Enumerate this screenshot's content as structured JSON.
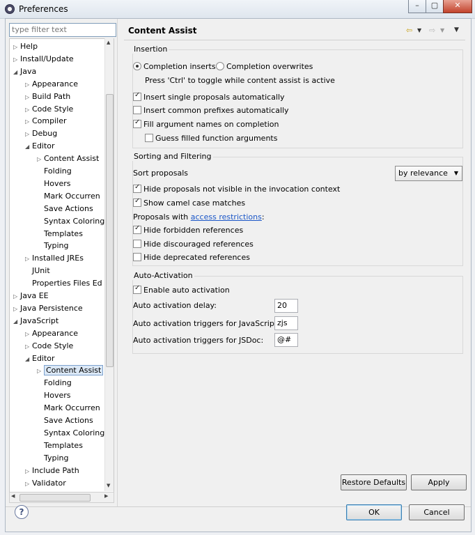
{
  "window": {
    "title": "Preferences"
  },
  "filter": {
    "placeholder": "type filter text"
  },
  "tree": [
    {
      "label": "Help",
      "twisty": "▷",
      "indent": 0
    },
    {
      "label": "Install/Update",
      "twisty": "▷",
      "indent": 0
    },
    {
      "label": "Java",
      "twisty": "◢",
      "indent": 0
    },
    {
      "label": "Appearance",
      "twisty": "▷",
      "indent": 1
    },
    {
      "label": "Build Path",
      "twisty": "▷",
      "indent": 1
    },
    {
      "label": "Code Style",
      "twisty": "▷",
      "indent": 1
    },
    {
      "label": "Compiler",
      "twisty": "▷",
      "indent": 1
    },
    {
      "label": "Debug",
      "twisty": "▷",
      "indent": 1
    },
    {
      "label": "Editor",
      "twisty": "◢",
      "indent": 1
    },
    {
      "label": "Content Assist",
      "twisty": "▷",
      "indent": 2
    },
    {
      "label": "Folding",
      "twisty": "",
      "indent": 2
    },
    {
      "label": "Hovers",
      "twisty": "",
      "indent": 2
    },
    {
      "label": "Mark Occurren",
      "twisty": "",
      "indent": 2
    },
    {
      "label": "Save Actions",
      "twisty": "",
      "indent": 2
    },
    {
      "label": "Syntax Coloring",
      "twisty": "",
      "indent": 2
    },
    {
      "label": "Templates",
      "twisty": "",
      "indent": 2
    },
    {
      "label": "Typing",
      "twisty": "",
      "indent": 2
    },
    {
      "label": "Installed JREs",
      "twisty": "▷",
      "indent": 1
    },
    {
      "label": "JUnit",
      "twisty": "",
      "indent": 1
    },
    {
      "label": "Properties Files Ed",
      "twisty": "",
      "indent": 1
    },
    {
      "label": "Java EE",
      "twisty": "▷",
      "indent": 0
    },
    {
      "label": "Java Persistence",
      "twisty": "▷",
      "indent": 0
    },
    {
      "label": "JavaScript",
      "twisty": "◢",
      "indent": 0
    },
    {
      "label": "Appearance",
      "twisty": "▷",
      "indent": 1
    },
    {
      "label": "Code Style",
      "twisty": "▷",
      "indent": 1
    },
    {
      "label": "Editor",
      "twisty": "◢",
      "indent": 1
    },
    {
      "label": "Content Assist",
      "twisty": "▷",
      "indent": 2,
      "selected": true
    },
    {
      "label": "Folding",
      "twisty": "",
      "indent": 2
    },
    {
      "label": "Hovers",
      "twisty": "",
      "indent": 2
    },
    {
      "label": "Mark Occurren",
      "twisty": "",
      "indent": 2
    },
    {
      "label": "Save Actions",
      "twisty": "",
      "indent": 2
    },
    {
      "label": "Syntax Coloring",
      "twisty": "",
      "indent": 2
    },
    {
      "label": "Templates",
      "twisty": "",
      "indent": 2
    },
    {
      "label": "Typing",
      "twisty": "",
      "indent": 2
    },
    {
      "label": "Include Path",
      "twisty": "▷",
      "indent": 1
    },
    {
      "label": "Validator",
      "twisty": "▷",
      "indent": 1
    }
  ],
  "page": {
    "title": "Content Assist",
    "insertion": {
      "label": "Insertion",
      "completion_inserts": "Completion inserts",
      "completion_overwrites": "Completion overwrites",
      "toggle_hint": "Press 'Ctrl' to toggle while content assist is active",
      "insert_single": "Insert single proposals automatically",
      "insert_common": "Insert common prefixes automatically",
      "fill_argument": "Fill argument names on completion",
      "guess_filled": "Guess filled function arguments"
    },
    "sorting": {
      "label": "Sorting and Filtering",
      "sort_proposals": "Sort proposals",
      "sort_value": "by relevance",
      "hide_not_visible": "Hide proposals not visible in the invocation context",
      "camel_case": "Show camel case matches",
      "proposals_with": "Proposals with",
      "access_restrictions": "access restrictions",
      "colon": ":",
      "hide_forbidden": "Hide forbidden references",
      "hide_discouraged": "Hide discouraged references",
      "hide_deprecated": "Hide deprecated references"
    },
    "auto": {
      "label": "Auto-Activation",
      "enable": "Enable auto activation",
      "delay_label": "Auto activation delay:",
      "delay_value": "20",
      "js_triggers_label": "Auto activation triggers for JavaScript:",
      "js_triggers_value": "zjs",
      "jsdoc_triggers_label": "Auto activation triggers for JSDoc:",
      "jsdoc_triggers_value": "@#"
    },
    "restore_defaults": "Restore Defaults",
    "apply": "Apply"
  },
  "footer": {
    "help": "?",
    "ok": "OK",
    "cancel": "Cancel"
  },
  "checked": {
    "completion_inserts": true,
    "completion_overwrites": false,
    "insert_single": true,
    "insert_common": false,
    "fill_argument": true,
    "guess_filled": false,
    "hide_not_visible": true,
    "camel_case": true,
    "hide_forbidden": true,
    "hide_discouraged": false,
    "hide_deprecated": false,
    "enable_auto": true
  }
}
